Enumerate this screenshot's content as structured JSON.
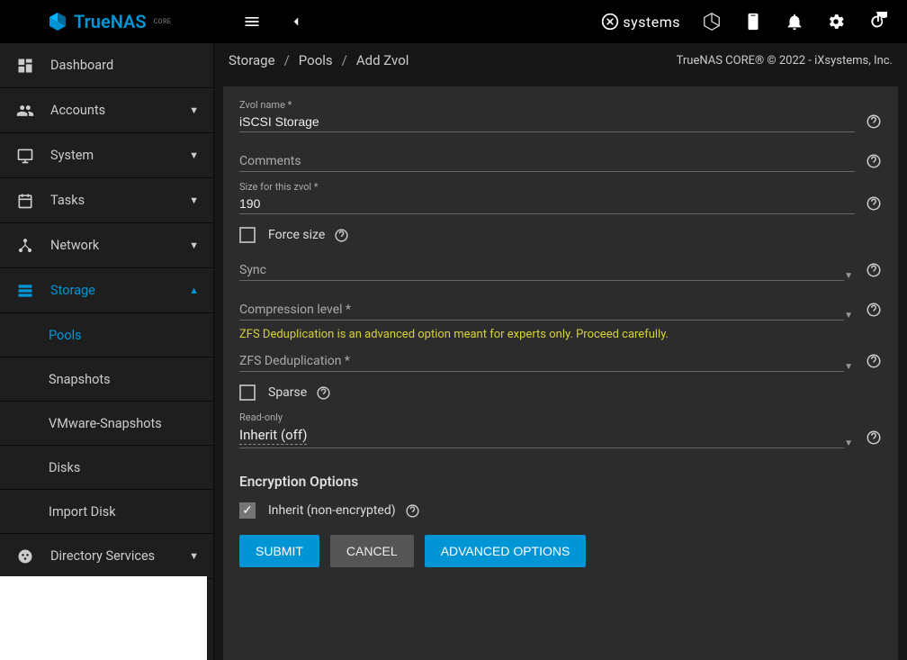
{
  "brand": {
    "name": "TrueNAS",
    "sub": "CORE",
    "company": "iXsystems"
  },
  "topbar": {
    "copyright": "TrueNAS CORE® © 2022 - iXsystems, Inc."
  },
  "breadcrumb": {
    "a": "Storage",
    "b": "Pools",
    "c": "Add Zvol"
  },
  "nav": {
    "dashboard": "Dashboard",
    "accounts": "Accounts",
    "system": "System",
    "tasks": "Tasks",
    "network": "Network",
    "storage": "Storage",
    "storage_sub": {
      "pools": "Pools",
      "snapshots": "Snapshots",
      "vmware": "VMware-Snapshots",
      "disks": "Disks",
      "import": "Import Disk"
    },
    "directory": "Directory Services"
  },
  "form": {
    "zvol_name_label": "Zvol name *",
    "zvol_name_value": "iSCSI Storage",
    "comments_label": "Comments",
    "size_label": "Size for this zvol *",
    "size_value": "190",
    "force_size_label": "Force size",
    "sync_label": "Sync",
    "compression_label": "Compression level *",
    "dedup_warning": "ZFS Deduplication is an advanced option meant for experts only. Proceed carefully.",
    "dedup_label": "ZFS Deduplication *",
    "sparse_label": "Sparse",
    "readonly_label": "Read-only",
    "readonly_value": "Inherit (off)",
    "encryption_title": "Encryption Options",
    "inherit_enc_label": "Inherit (non-encrypted)"
  },
  "buttons": {
    "submit": "SUBMIT",
    "cancel": "CANCEL",
    "advanced": "ADVANCED OPTIONS"
  }
}
